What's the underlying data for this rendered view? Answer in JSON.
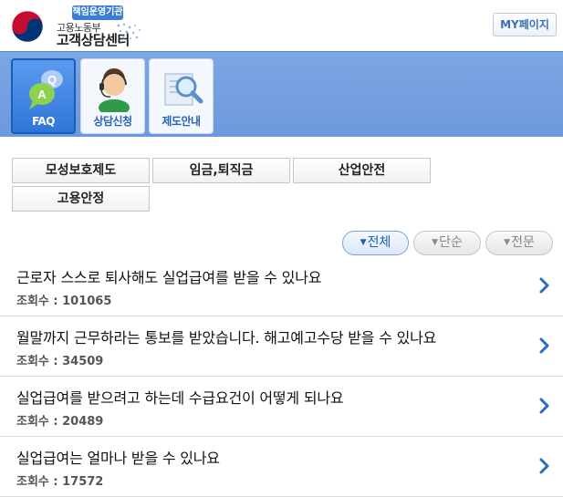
{
  "header": {
    "badge": "책임운영기관",
    "agency": "고용노동부",
    "center": "고객상담센터",
    "my_page": "MY페이지"
  },
  "nav": {
    "items": [
      {
        "label": "FAQ",
        "icon": "qa-bubble-icon",
        "active": true
      },
      {
        "label": "상담신청",
        "icon": "counselor-icon",
        "active": false
      },
      {
        "label": "제도안내",
        "icon": "magnifier-document-icon",
        "active": false
      }
    ]
  },
  "categories": [
    "모성보호제도",
    "임금,퇴직금",
    "산업안전",
    "고용안정"
  ],
  "filters": [
    {
      "label": "전체",
      "active": true
    },
    {
      "label": "단순",
      "active": false
    },
    {
      "label": "전문",
      "active": false
    }
  ],
  "faq": [
    {
      "question": "근로자 스스로 퇴사해도 실업급여를 받을 수 있나요",
      "views": "조회수 : 101065"
    },
    {
      "question": "월말까지 근무하라는 통보를 받았습니다. 해고예고수당 받을 수 있나요",
      "views": "조회수 : 34509"
    },
    {
      "question": "실업급여를 받으려고 하는데 수급요건이 어떻게 되나요",
      "views": "조회수 : 20489"
    },
    {
      "question": "실업급여는 얼마나 받을 수 있나요",
      "views": "조회수 : 17572"
    }
  ],
  "colors": {
    "nav_band": "#6c99dd",
    "accent": "#1e5fb4",
    "active_tile": "#2f76d8"
  }
}
